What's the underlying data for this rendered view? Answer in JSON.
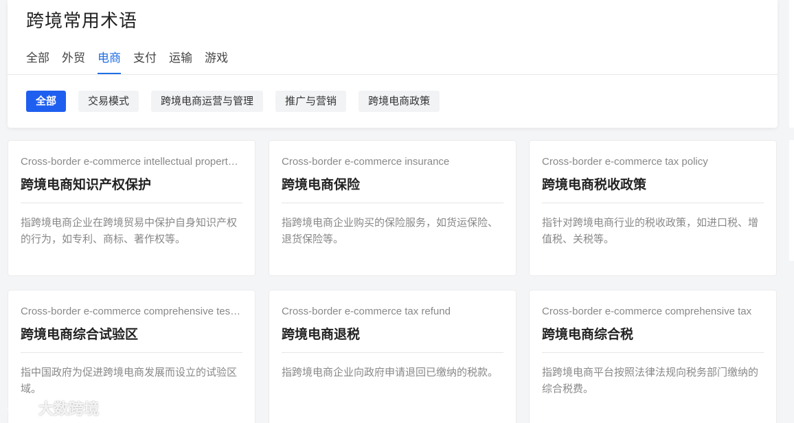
{
  "header": {
    "title": "跨境常用术语",
    "tabs": [
      {
        "label": "全部"
      },
      {
        "label": "外贸"
      },
      {
        "label": "电商",
        "active": true
      },
      {
        "label": "支付"
      },
      {
        "label": "运输"
      },
      {
        "label": "游戏"
      }
    ],
    "chips": [
      {
        "label": "全部",
        "active": true
      },
      {
        "label": "交易模式"
      },
      {
        "label": "跨境电商运营与管理"
      },
      {
        "label": "推广与营销"
      },
      {
        "label": "跨境电商政策"
      }
    ]
  },
  "cards": [
    {
      "en": "Cross-border e-commerce intellectual property protection",
      "zh": "跨境电商知识产权保护",
      "desc": "指跨境电商企业在跨境贸易中保护自身知识产权的行为，如专利、商标、著作权等。"
    },
    {
      "en": "Cross-border e-commerce insurance",
      "zh": "跨境电商保险",
      "desc": "指跨境电商企业购买的保险服务，如货运保险、退货保险等。"
    },
    {
      "en": "Cross-border e-commerce tax policy",
      "zh": "跨境电商税收政策",
      "desc": "指针对跨境电商行业的税收政策，如进口税、增值税、关税等。"
    },
    {
      "en": "Cross-border e-commerce comprehensive test zone",
      "zh": "跨境电商综合试验区",
      "desc": "指中国政府为促进跨境电商发展而设立的试验区域。"
    },
    {
      "en": "Cross-border e-commerce tax refund",
      "zh": "跨境电商退税",
      "desc": "指跨境电商企业向政府申请退回已缴纳的税款。"
    },
    {
      "en": "Cross-border e-commerce comprehensive tax",
      "zh": "跨境电商综合税",
      "desc": "指跨境电商平台按照法律法规向税务部门缴纳的综合税费。"
    }
  ],
  "watermark": {
    "text": "大数跨境"
  },
  "colors": {
    "accent": "#1f6fe5",
    "chip_active": "#1f5ff0"
  }
}
